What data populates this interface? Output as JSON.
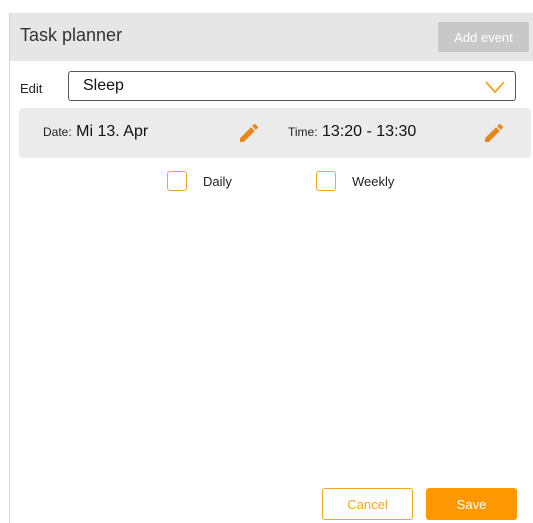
{
  "header": {
    "title": "Task planner",
    "add_event_label": "Add event"
  },
  "edit": {
    "label": "Edit",
    "selected_value": "Sleep",
    "dropdown_icon": "chevron-down-icon"
  },
  "info": {
    "date_label": "Date:",
    "date_value": "Mi 13. Apr",
    "time_label": "Time:",
    "time_value": "13:20 - 13:30",
    "edit_icon": "pencil-icon"
  },
  "recurrence": {
    "daily_label": "Daily",
    "daily_checked": false,
    "weekly_label": "Weekly",
    "weekly_checked": false
  },
  "footer": {
    "cancel_label": "Cancel",
    "save_label": "Save"
  },
  "colors": {
    "accent": "#ff9800",
    "accent_outline": "#f5a623",
    "pencil": "#e8861a",
    "header_bg": "#e6e6e6",
    "card_bg": "#ebebeb",
    "disabled_button": "#c8c8c8"
  }
}
